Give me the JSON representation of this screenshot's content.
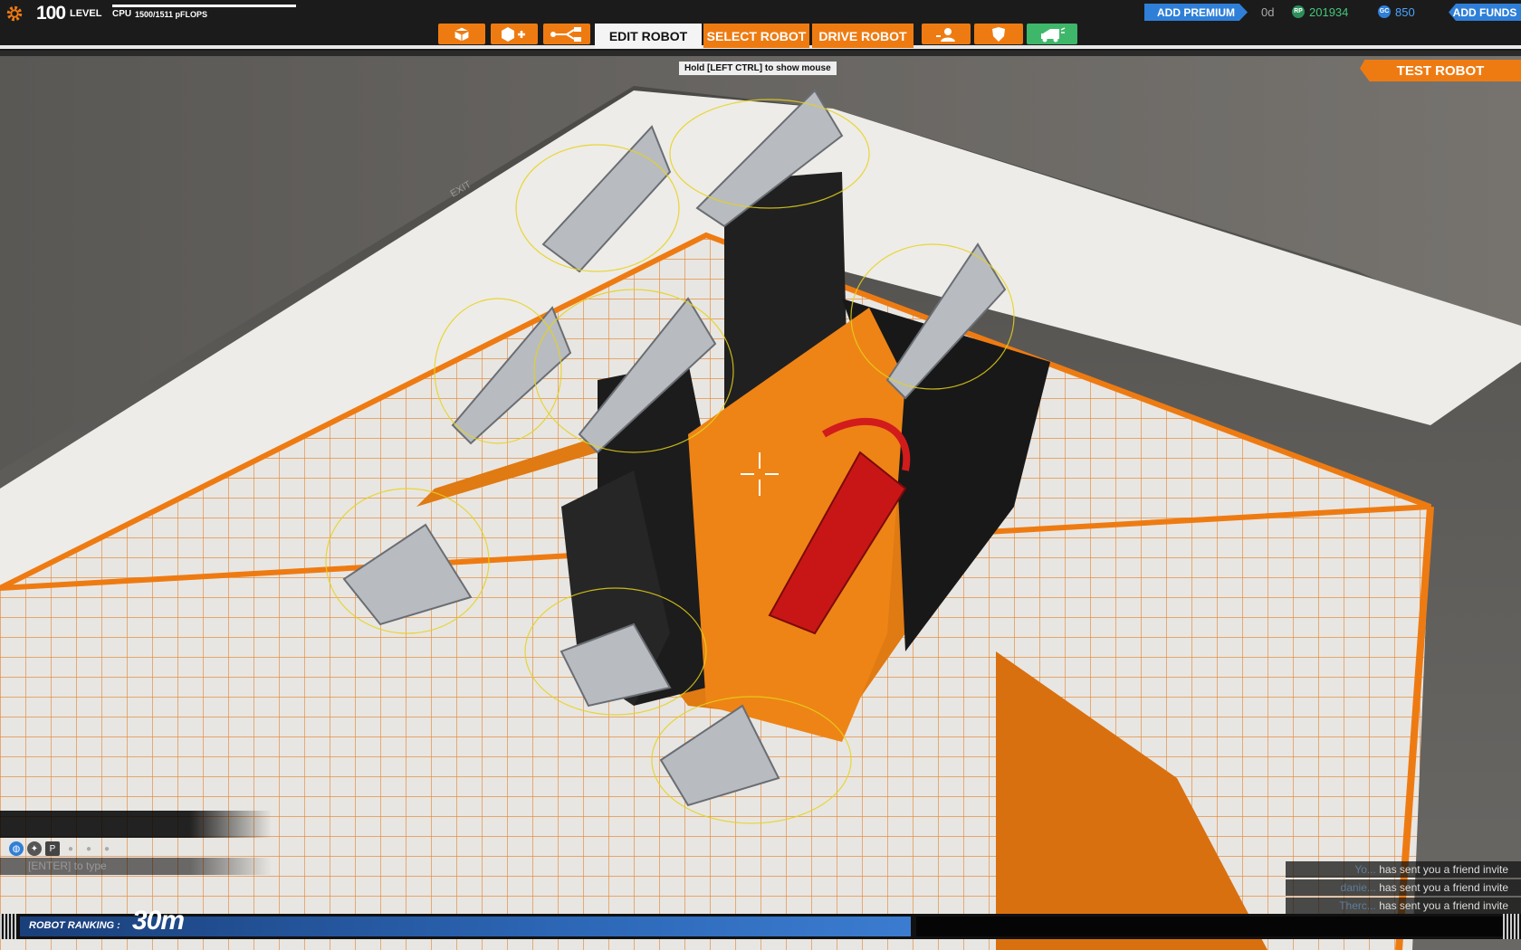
{
  "header": {
    "level_number": "100",
    "level_label": "LEVEL",
    "cpu_label": "CPU",
    "cpu_value": "1500/1511 pFLOPS",
    "premium_label": "ADD PREMIUM",
    "premium_timer": "0d",
    "robot_points": "201934",
    "galaxy_credits": "850",
    "funds_label": "ADD FUNDS"
  },
  "toolbar": {
    "icons": [
      "cube-icon",
      "cube-plus-icon",
      "branch-icon",
      "profile-icon",
      "shield-icon",
      "garage-icon"
    ]
  },
  "tabs": {
    "edit": "EDIT ROBOT",
    "select": "SELECT ROBOT",
    "drive": "DRIVE ROBOT"
  },
  "hint": "Hold [LEFT CTRL] to show mouse",
  "test_robot_label": "TEST ROBOT",
  "scene": {
    "exit_sign": "EXIT"
  },
  "chat": {
    "input_placeholder": "[ENTER] to type"
  },
  "notifications": [
    {
      "name": "Yo...",
      "message": "has sent you a friend invite"
    },
    {
      "name": "danie...",
      "message": "has sent you a friend invite"
    },
    {
      "name": "Therc...",
      "message": "has sent you a friend invite"
    }
  ],
  "ranking": {
    "label": "ROBOT RANKING :",
    "value": "30m"
  },
  "colors": {
    "accent_orange": "#ee7b12",
    "premium_blue": "#2f7fd8",
    "rp_green": "#44c77a",
    "gc_blue": "#4aa4ff"
  }
}
